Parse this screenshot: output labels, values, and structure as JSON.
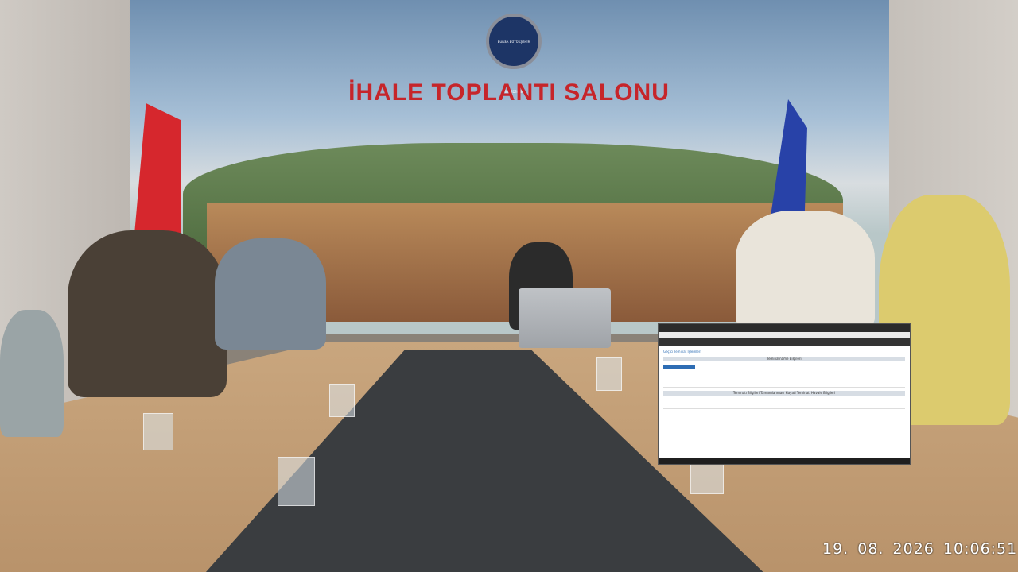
{
  "scene": {
    "wall_sign": "İHALE TOPLANTI SALONU",
    "logo_text": "BURSA BÜYÜKŞEHİR BELEDİYESİ"
  },
  "screen_inset": {
    "page_heading": "Geçici Teminat İşlemleri",
    "section_1": "Teminatname Bilgileri",
    "section_2": "Teminatı Bilgileri Tamamlanması Hayati Teminatı Havale Bilgileri"
  },
  "overlay": {
    "timestamp": "19. 08. 2026  10:06:51"
  },
  "colors": {
    "sign_red": "#c6252a",
    "flag_turkey": "#d6272d",
    "flag_bursa": "#2842a8",
    "table_wood": "#c9a67e",
    "runner": "#3a3d40"
  }
}
